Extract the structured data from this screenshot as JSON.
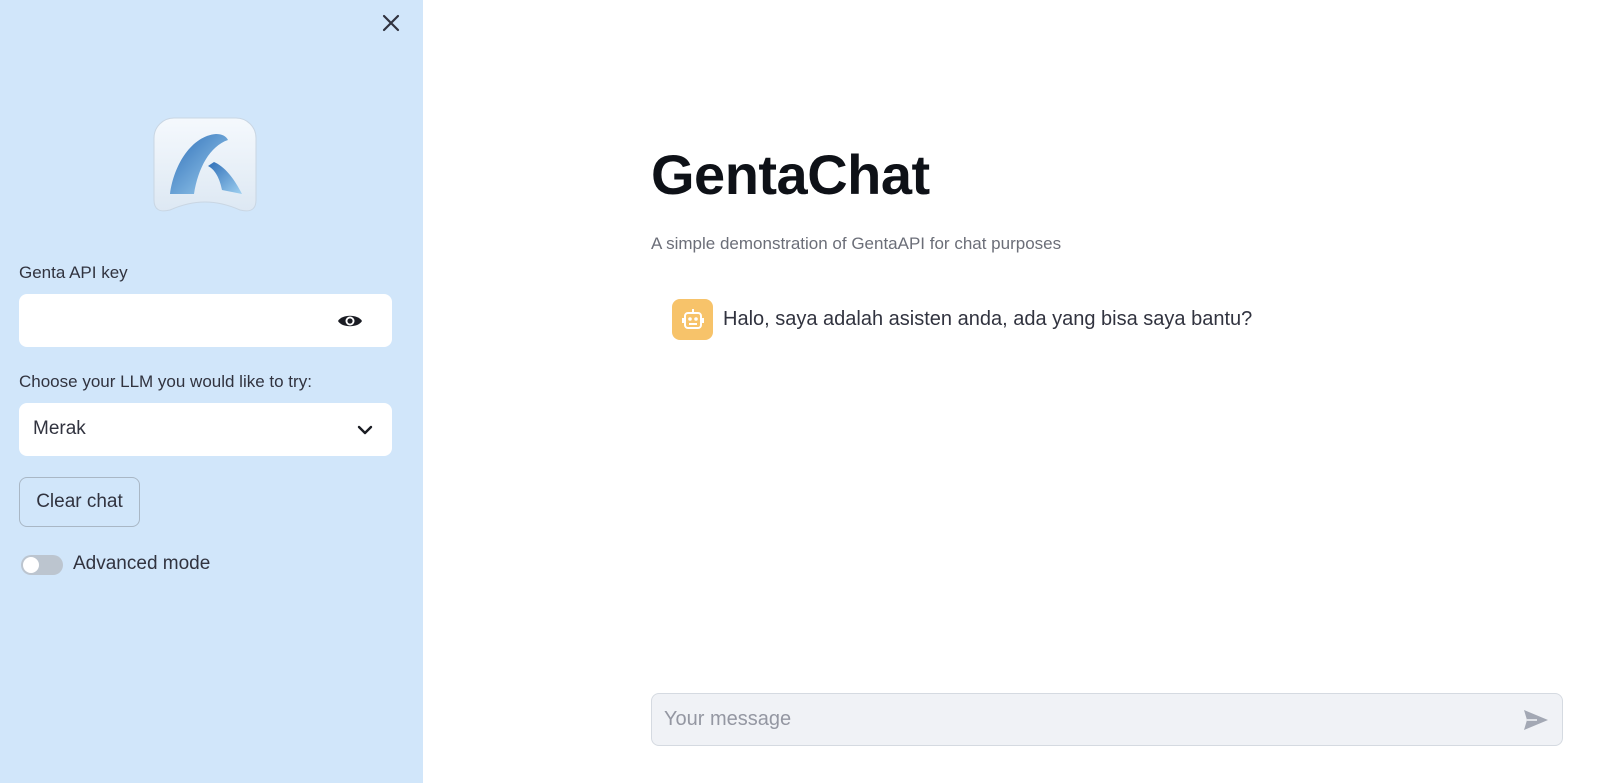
{
  "sidebar": {
    "close_icon": "close-icon",
    "logo_icon": "genta-logo",
    "api_key": {
      "label": "Genta API key",
      "value": "",
      "reveal_icon": "eye-icon"
    },
    "llm": {
      "label": "Choose your LLM you would like to try:",
      "selected": "Merak",
      "dropdown_icon": "chevron-down-icon"
    },
    "clear_button_label": "Clear chat",
    "advanced_mode": {
      "label": "Advanced mode",
      "enabled": false
    },
    "background_color": "#d1e6fa"
  },
  "main": {
    "title": "GentaChat",
    "subtitle": "A simple demonstration of GentaAPI for chat purposes",
    "messages": [
      {
        "role": "assistant",
        "avatar_icon": "robot-icon",
        "avatar_color": "#f7c36a",
        "text": "Halo, saya adalah asisten anda, ada yang bisa saya bantu?"
      }
    ],
    "chat_input": {
      "placeholder": "Your message",
      "send_icon": "send-icon"
    }
  }
}
